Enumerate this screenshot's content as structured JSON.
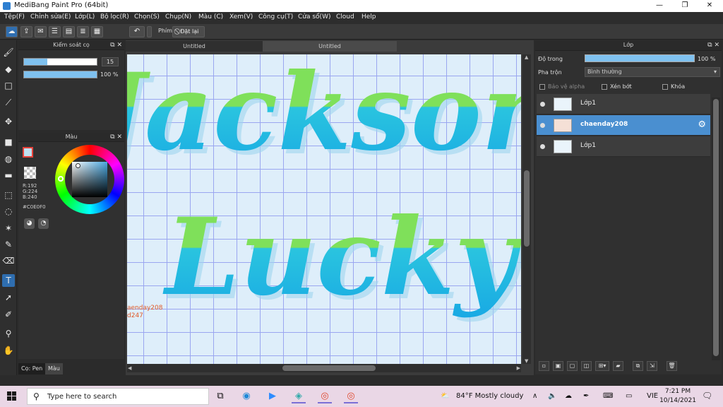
{
  "window": {
    "title": "MediBang Paint Pro (64bit)",
    "minimize": "—",
    "maximize": "❐",
    "close": "✕"
  },
  "menu": [
    "Tệp(F)",
    "Chỉnh sửa(E)",
    "Lớp(L)",
    "Bộ lọc(R)",
    "Chọn(S)",
    "Chụp(N)",
    "Màu (C)",
    "Xem(V)",
    "Công cụ(T)",
    "Cửa sổ(W)",
    "Cloud",
    "Help"
  ],
  "toolbar": {
    "undo": "↶",
    "shortcut_label": "Phím",
    "reset_label": "Đặt lại"
  },
  "brush_panel": {
    "title": "Kiểm soát cọ",
    "size_value": "15",
    "size_fraction": 0.32,
    "opacity_value": "100 %",
    "opacity_fraction": 1.0
  },
  "color_panel": {
    "title": "Màu",
    "r": "R:192",
    "g": "G:224",
    "b": "B:240",
    "hex": "#C0E0F0",
    "fg_color": "#c0e0f0"
  },
  "left_tabs": [
    "Cọ: Pen",
    "Màu"
  ],
  "documents": {
    "tabs": [
      "Untitled",
      "Untitled"
    ],
    "canvas_text": [
      "Jackson",
      "Lucky"
    ],
    "signature": [
      "aenday208",
      "d247"
    ]
  },
  "layer_panel": {
    "title": "Lớp",
    "opacity_label": "Độ trong",
    "opacity_value": "100 %",
    "blend_label": "Pha trộn",
    "blend_value": "Bình thường",
    "protect_alpha": "Bảo vệ alpha",
    "clipping": "Xén bớt",
    "lock": "Khóa",
    "layers": [
      {
        "name": "Lớp1",
        "selected": false
      },
      {
        "name": "chaenday208",
        "selected": true
      },
      {
        "name": "Lớp1",
        "selected": false
      }
    ]
  },
  "taskbar": {
    "search_placeholder": "Type here to search",
    "weather": "84°F  Mostly cloudy",
    "language": "VIE",
    "time": "7:21 PM",
    "date": "10/14/2021"
  }
}
